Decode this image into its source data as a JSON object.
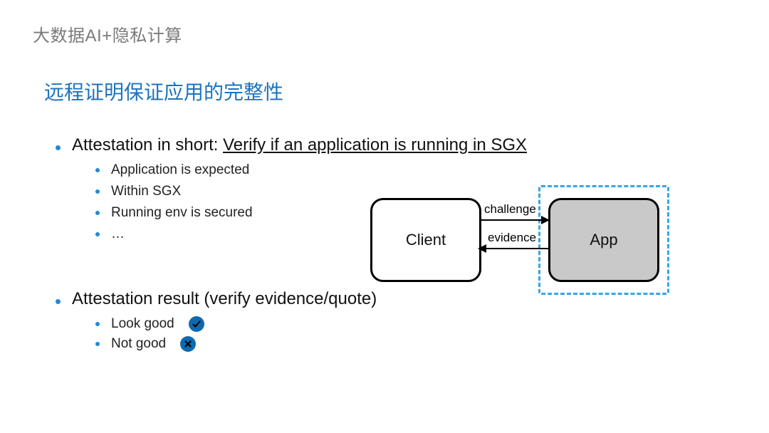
{
  "header": "大数据AI+隐私计算",
  "title": "远程证明保证应用的完整性",
  "bullets": {
    "b1_prefix": "Attestation in short: ",
    "b1_underlined": "Verify if an application is running in SGX",
    "b1_subs": [
      "Application is expected",
      "Within SGX",
      "Running env is secured",
      "…"
    ],
    "b2": "Attestation result (verify evidence/quote)",
    "b2_subs": [
      {
        "label": "Look good",
        "mark": "check"
      },
      {
        "label": "Not good",
        "mark": "x"
      }
    ]
  },
  "diagram": {
    "client": "Client",
    "app": "App",
    "challenge": "challenge",
    "evidence": "evidence"
  }
}
